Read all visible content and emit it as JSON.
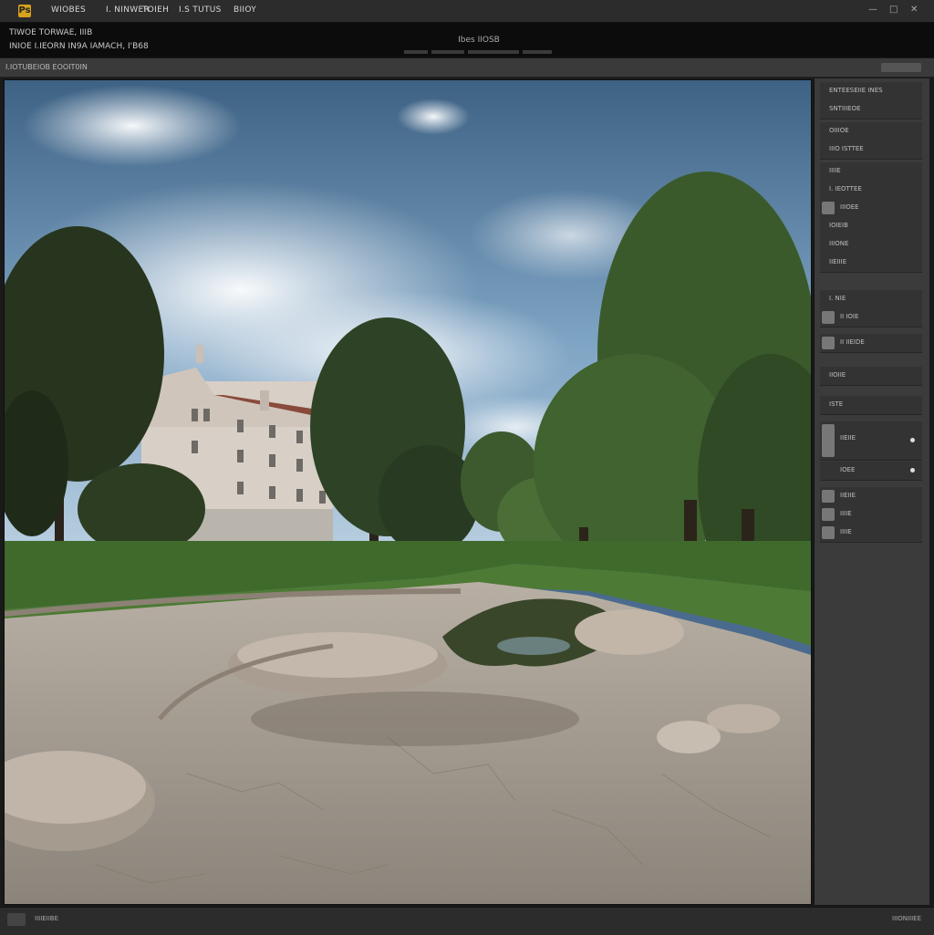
{
  "menubar": {
    "app_icon": "photo-app-icon",
    "items": [
      "WIOBES",
      "I. NINWER",
      "TOIEH",
      "I.S TUTUS",
      "BIIOY"
    ],
    "window_buttons": [
      "—",
      "□",
      "✕"
    ]
  },
  "infobar": {
    "line1": "TIWOE TORWAE, IIIB",
    "line2": "INIOE I.IEORN IN9A IAMACH, I'B68",
    "center_title": "Ibes IIOSB"
  },
  "toolbar2": {
    "label": "I.IOTUBEIOB  EOOIT0IN"
  },
  "panel": {
    "rows": [
      {
        "label": "ENTEESEIIE INES"
      },
      {
        "label": "SNTIIIEOE"
      },
      {
        "label": "OIIIOE"
      },
      {
        "label": "IIIO  ISTTEE"
      },
      {
        "label": "IIIIE"
      },
      {
        "label": "I. IEOTTEE"
      },
      {
        "label": "IIIOEE"
      },
      {
        "label": "IOIEIB"
      },
      {
        "label": "IIIONE"
      },
      {
        "label": "IIEIIIE"
      },
      {
        "label": "I. NIE"
      },
      {
        "label": "II IOIE"
      },
      {
        "label": "II IIEIDE"
      },
      {
        "label": "IIOIIE"
      },
      {
        "label": "ISTE"
      },
      {
        "label": "IIEIIE"
      },
      {
        "label": "IOEE"
      },
      {
        "label": "IIEIIE"
      },
      {
        "label": "IIIIE"
      },
      {
        "label": "IIIIE"
      }
    ]
  },
  "statusbar": {
    "left": "IIIIEIIBE",
    "right": "IIIONIIIEE"
  },
  "colors": {
    "sky": "#4a6b8e",
    "accent": "#d7a21b"
  }
}
